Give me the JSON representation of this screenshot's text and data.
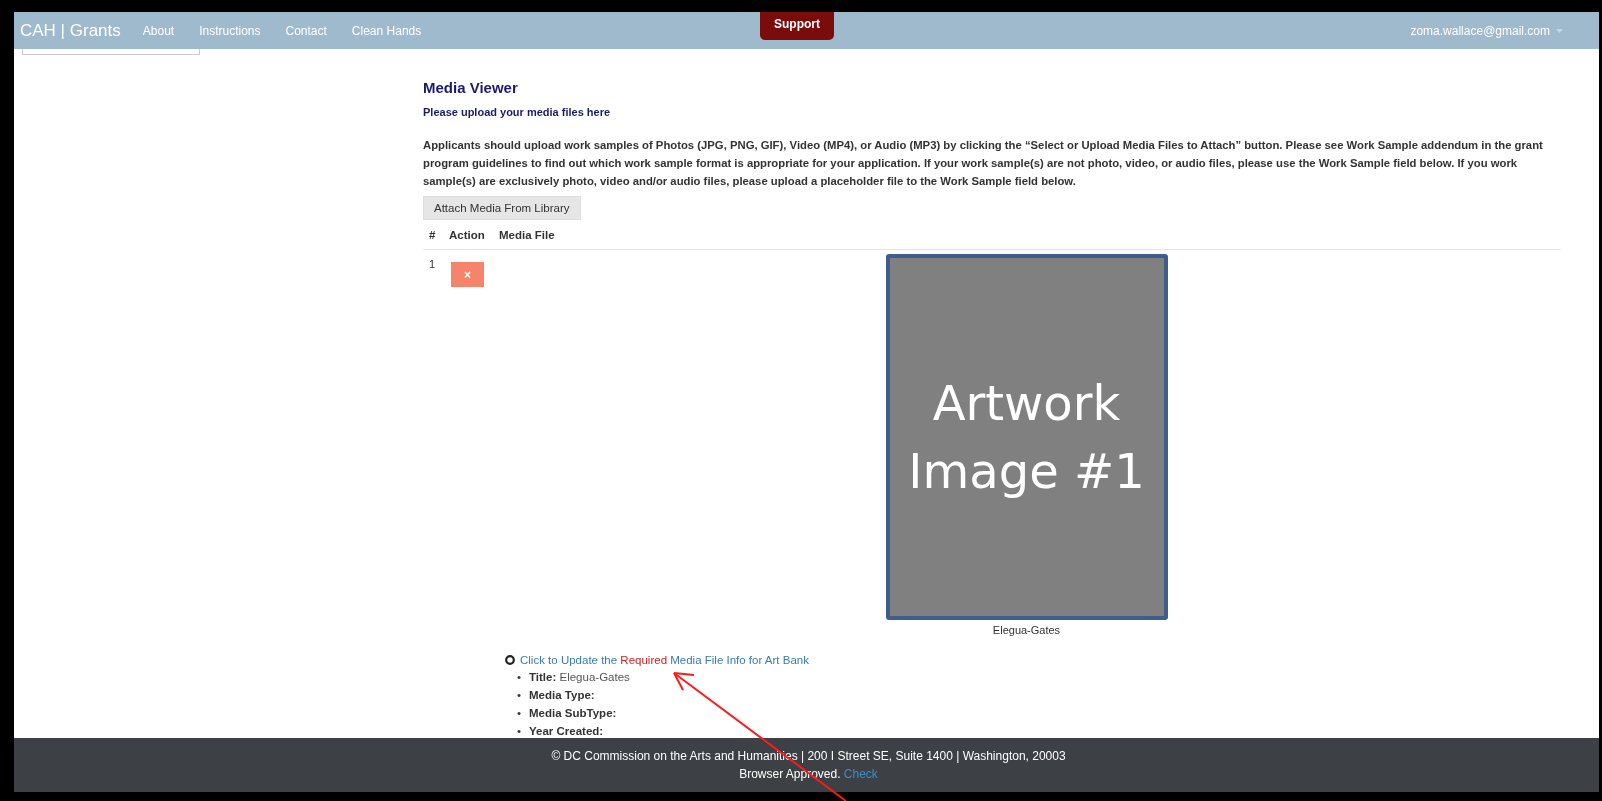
{
  "nav": {
    "brand": "CAH | Grants",
    "links": [
      "About",
      "Instructions",
      "Contact",
      "Clean Hands"
    ],
    "support": "Support",
    "user": "zoma.wallace@gmail.com"
  },
  "page": {
    "title": "Media Viewer",
    "subtitle": "Please upload your media files here",
    "intro": "Applicants should upload work samples of Photos (JPG, PNG, GIF), Video (MP4), or Audio (MP3) by clicking the “Select or Upload Media Files to Attach” button. Please see Work Sample addendum in the grant program guidelines to find out which work sample format is appropriate for your application. If your work sample(s) are not photo, video, or audio files, please use the Work Sample field below. If you work sample(s) are exclusively photo, video and/or audio files, please upload a placeholder file to the Work Sample field below.",
    "attach_button": "Attach Media From Library"
  },
  "table": {
    "columns": [
      "#",
      "Action",
      "Media File"
    ],
    "rows": [
      {
        "number": "1",
        "remove": "×",
        "image_label": "Artwork Image #1",
        "caption": "Elegua-Gates"
      }
    ]
  },
  "media_info": {
    "link": {
      "before": "Click to Update the ",
      "highlight": "Required",
      "after": " Media File Info for Art Bank"
    },
    "fields": [
      {
        "bullet": "•",
        "label": "Title:",
        "value": "Elegua-Gates"
      },
      {
        "bullet": "•",
        "label": "Media Type:"
      },
      {
        "bullet": "•",
        "label": "Media SubType:"
      },
      {
        "bullet": "•",
        "label": "Year Created:"
      }
    ]
  },
  "footer": {
    "copyright": "© DC Commission on the Arts and Humanities | 200 I Street SE, Suite 1400 | Washington, 20003",
    "browser_text": "Browser Approved.",
    "browser_link": "Check"
  }
}
